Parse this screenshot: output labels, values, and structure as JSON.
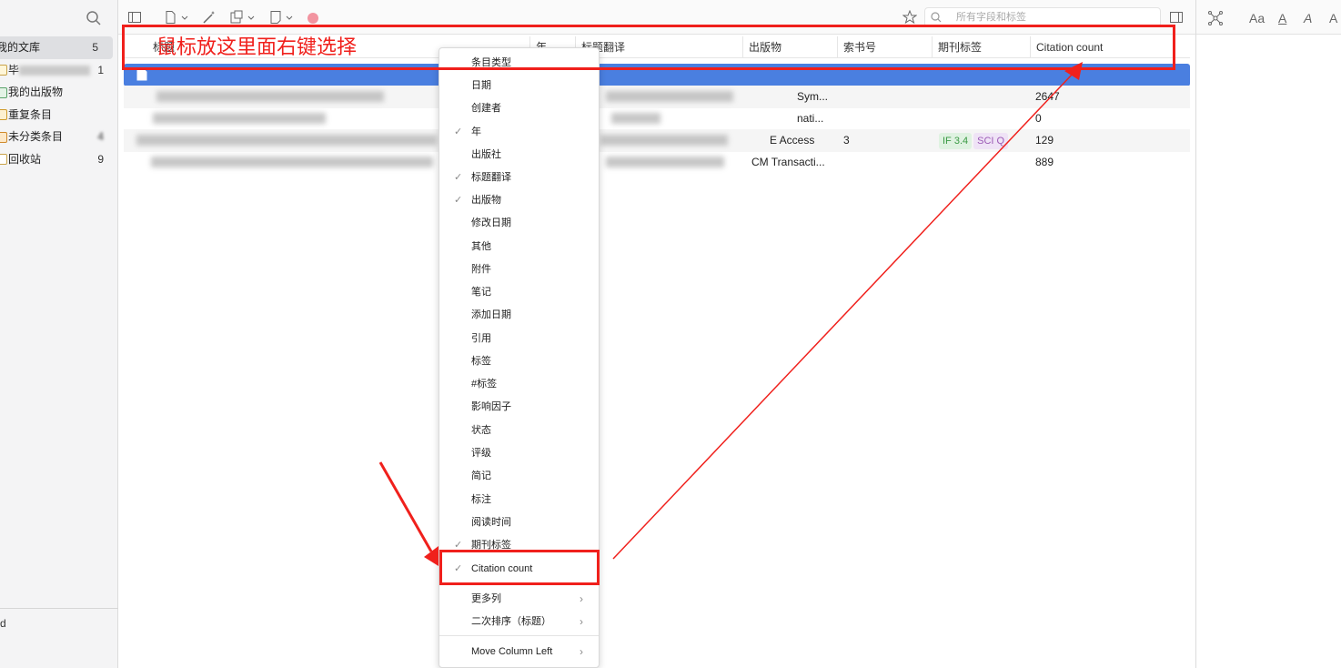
{
  "sidebar": {
    "items": [
      {
        "label": "我的文库",
        "count": "5"
      },
      {
        "label": "毕",
        "count": "1"
      },
      {
        "label": "我的出版物",
        "count": ""
      },
      {
        "label": "重复条目",
        "count": ""
      },
      {
        "label": "未分类条目",
        "count": "4"
      },
      {
        "label": "回收站",
        "count": "9"
      }
    ],
    "footer_text": "d"
  },
  "toolbar": {
    "search_placeholder": "所有字段和标签",
    "right_icons": [
      "Aa",
      "A",
      "A",
      "A"
    ]
  },
  "table": {
    "columns": [
      "标题",
      "年",
      "标题翻译",
      "出版物",
      "索书号",
      "期刊标签",
      "Citation count"
    ],
    "rows": [
      {
        "publication": "",
        "call_number": "",
        "citation": ""
      },
      {
        "publication": "Sym...",
        "call_number": "",
        "citation": "2647"
      },
      {
        "publication": "nati...",
        "call_number": "",
        "citation": "0"
      },
      {
        "publication": "E Access",
        "call_number": "3",
        "citation": "129",
        "tags": [
          "IF 3.4",
          "SCI Q"
        ]
      },
      {
        "publication": "CM Transacti...",
        "call_number": "",
        "citation": "889"
      }
    ]
  },
  "context_menu": {
    "items": [
      {
        "label": "条目类型",
        "checked": false
      },
      {
        "label": "日期",
        "checked": false
      },
      {
        "label": "创建者",
        "checked": false
      },
      {
        "label": "年",
        "checked": true
      },
      {
        "label": "出版社",
        "checked": false
      },
      {
        "label": "标题翻译",
        "checked": true
      },
      {
        "label": "出版物",
        "checked": true
      },
      {
        "label": "修改日期",
        "checked": false
      },
      {
        "label": "其他",
        "checked": false
      },
      {
        "label": "附件",
        "checked": false
      },
      {
        "label": "笔记",
        "checked": false
      },
      {
        "label": "添加日期",
        "checked": false
      },
      {
        "label": "引用",
        "checked": false
      },
      {
        "label": "标签",
        "checked": false
      },
      {
        "label": "#标签",
        "checked": false
      },
      {
        "label": "影响因子",
        "checked": false
      },
      {
        "label": "状态",
        "checked": false
      },
      {
        "label": "评级",
        "checked": false
      },
      {
        "label": "简记",
        "checked": false
      },
      {
        "label": "标注",
        "checked": false
      },
      {
        "label": "阅读时间",
        "checked": false
      },
      {
        "label": "期刊标签",
        "checked": true
      },
      {
        "label": "Citation count",
        "checked": true
      }
    ],
    "submenus": [
      {
        "label": "更多列"
      },
      {
        "label": "二次排序（标题）"
      },
      {
        "label": "Move Column Left"
      }
    ]
  },
  "annotation": {
    "text": "鼠标放这里面右键选择",
    "color": "#f0201c"
  },
  "colors": {
    "selected_row": "#4a7fe0",
    "annotation_red": "#f0201c"
  }
}
